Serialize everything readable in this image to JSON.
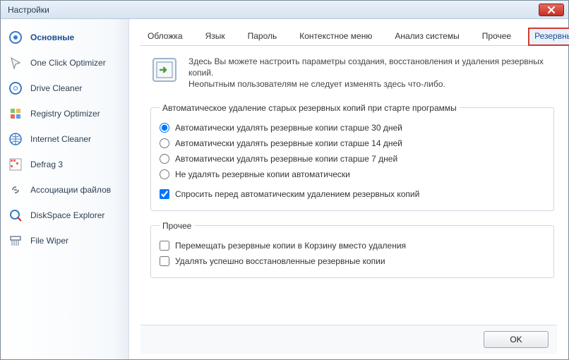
{
  "window": {
    "title": "Настройки"
  },
  "sidebar": {
    "items": [
      {
        "label": "Основные"
      },
      {
        "label": "One Click Optimizer"
      },
      {
        "label": "Drive Cleaner"
      },
      {
        "label": "Registry Optimizer"
      },
      {
        "label": "Internet Cleaner"
      },
      {
        "label": "Defrag 3"
      },
      {
        "label": "Ассоциации файлов"
      },
      {
        "label": "DiskSpace Explorer"
      },
      {
        "label": "File Wiper"
      }
    ]
  },
  "tabs": [
    {
      "label": "Обложка"
    },
    {
      "label": "Язык"
    },
    {
      "label": "Пароль"
    },
    {
      "label": "Контекстное меню"
    },
    {
      "label": "Анализ системы"
    },
    {
      "label": "Прочее"
    },
    {
      "label": "Резервные копии"
    }
  ],
  "active_tab_index": 6,
  "intro": {
    "line1": "Здесь Вы можете настроить параметры создания, восстановления и удаления резервных копий.",
    "line2": "Неопытным пользователям не следует изменять здесь что-либо."
  },
  "group_autodelete": {
    "legend": "Автоматическое удаление старых резервных копий при старте программы",
    "options": [
      {
        "label": "Автоматически удалять резервные копии старше 30 дней"
      },
      {
        "label": "Автоматически удалять резервные копии старше 14 дней"
      },
      {
        "label": "Автоматически удалять резервные копии старше 7 дней"
      },
      {
        "label": "Не удалять резервные копии автоматически"
      }
    ],
    "selected": 0,
    "confirm": {
      "label": "Спросить перед автоматическим удалением резервных копий",
      "checked": true
    }
  },
  "group_other": {
    "legend": "Прочее",
    "options": [
      {
        "label": "Перемещать резервные копии в Корзину вместо удаления",
        "checked": false
      },
      {
        "label": "Удалять успешно восстановленные резервные копии",
        "checked": false
      }
    ]
  },
  "footer": {
    "ok": "OK"
  }
}
